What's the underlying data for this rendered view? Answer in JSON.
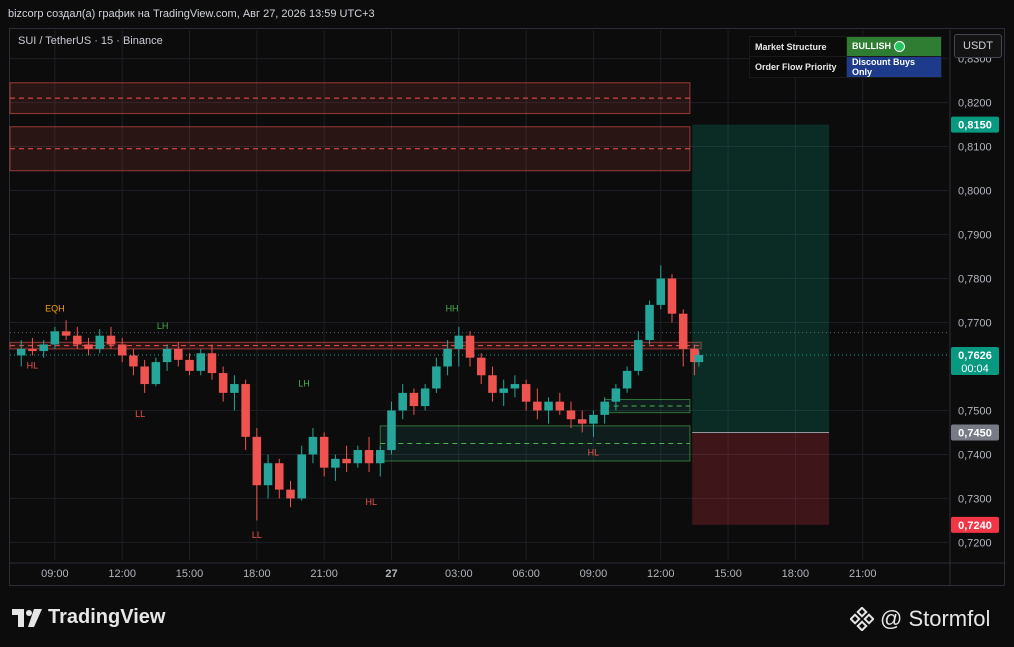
{
  "header": {
    "caption": "bizcorp создал(а) график на TradingView.com, Авг 27, 2026 13:59 UTC+3",
    "symbol": "SUI / TetherUS · 15 · Binance",
    "currency": "USDT"
  },
  "status_table": {
    "row1_label": "Market Structure",
    "row1_value": "BULLISH",
    "row2_label": "Order Flow Priority",
    "row2_value": "Discount Buys Only"
  },
  "footer": {
    "logo": "TradingView",
    "credit": "@ Stormfol"
  },
  "colors": {
    "up": "#26a69a",
    "down": "#ef5350",
    "bg": "#0c0c0c",
    "accent_green": "#22ab94",
    "accent_red": "#f23645"
  },
  "chart_data": {
    "type": "candlestick",
    "ylim": [
      0.716,
      0.8365
    ],
    "y_ticks": [
      "0,8300",
      "0,8200",
      "0,8100",
      "0,8000",
      "0,7900",
      "0,7800",
      "0,7700",
      "0,7500",
      "0,7400",
      "0,7300",
      "0,7200"
    ],
    "y_tick_values": [
      0.83,
      0.82,
      0.81,
      0.8,
      0.79,
      0.78,
      0.77,
      0.75,
      0.74,
      0.73,
      0.72
    ],
    "x_ticks": [
      "09:00",
      "12:00",
      "15:00",
      "18:00",
      "21:00",
      "27",
      "03:00",
      "06:00",
      "09:00",
      "12:00",
      "15:00",
      "18:00",
      "21:00"
    ],
    "x_tick_hours": [
      9,
      12,
      15,
      18,
      21,
      24,
      27,
      30,
      33,
      36,
      39,
      42,
      45
    ],
    "x_range_hours": [
      7.0,
      48.8
    ],
    "last_bar_hour": 37.7,
    "price_labels": [
      {
        "text": "0,8150",
        "value": 0.815,
        "color": "#089981"
      },
      {
        "text": "0,7626",
        "sub": "00:04",
        "value": 0.7626,
        "color": "#089981"
      },
      {
        "text": "0,7450",
        "value": 0.745,
        "color": "#787b86"
      },
      {
        "text": "0,7240",
        "value": 0.724,
        "color": "#f23645"
      }
    ],
    "position": {
      "entry": 0.745,
      "target": 0.815,
      "stop": 0.724,
      "start_hour": 37.4,
      "end_hour": 43.5
    },
    "structure_labels": [
      {
        "text": "EQH",
        "hour": 9.0,
        "value": 0.7725,
        "color": "#f59e0b"
      },
      {
        "text": "HL",
        "hour": 8.0,
        "value": 0.7595,
        "color": "#ef5350"
      },
      {
        "text": "LH",
        "hour": 13.8,
        "value": 0.7685,
        "color": "#4caf50"
      },
      {
        "text": "LL",
        "hour": 12.8,
        "value": 0.7485,
        "color": "#ef5350"
      },
      {
        "text": "LH",
        "hour": 20.1,
        "value": 0.7555,
        "color": "#4caf50"
      },
      {
        "text": "LL",
        "hour": 18.0,
        "value": 0.721,
        "color": "#ef5350"
      },
      {
        "text": "HL",
        "hour": 23.1,
        "value": 0.7285,
        "color": "#ef5350"
      },
      {
        "text": "HH",
        "hour": 26.7,
        "value": 0.7725,
        "color": "#4caf50"
      },
      {
        "text": "HL",
        "hour": 33.0,
        "value": 0.7398,
        "color": "#ef5350"
      }
    ],
    "zones": [
      {
        "y1": 0.8245,
        "y2": 0.8175,
        "h1": 7.0,
        "h2": 37.3,
        "color": "red"
      },
      {
        "y1": 0.8145,
        "y2": 0.8045,
        "h1": 7.0,
        "h2": 37.3,
        "color": "red"
      },
      {
        "y1": 0.7655,
        "y2": 0.764,
        "h1": 7.0,
        "h2": 37.8,
        "color": "red"
      },
      {
        "y1": 0.7465,
        "y2": 0.7385,
        "h1": 23.5,
        "h2": 37.3,
        "color": "green"
      },
      {
        "y1": 0.7525,
        "y2": 0.7495,
        "h1": 33.5,
        "h2": 37.3,
        "color": "green"
      }
    ],
    "candles": [
      [
        7.5,
        0.7625,
        0.766,
        0.76,
        0.764
      ],
      [
        8.0,
        0.764,
        0.7665,
        0.7625,
        0.7635
      ],
      [
        8.5,
        0.7635,
        0.766,
        0.762,
        0.765
      ],
      [
        9.0,
        0.765,
        0.769,
        0.764,
        0.768
      ],
      [
        9.5,
        0.768,
        0.7705,
        0.766,
        0.767
      ],
      [
        10.0,
        0.767,
        0.769,
        0.764,
        0.765
      ],
      [
        10.5,
        0.765,
        0.7665,
        0.7625,
        0.764
      ],
      [
        11.0,
        0.764,
        0.7685,
        0.763,
        0.767
      ],
      [
        11.5,
        0.767,
        0.769,
        0.764,
        0.765
      ],
      [
        12.0,
        0.765,
        0.7665,
        0.761,
        0.7625
      ],
      [
        12.5,
        0.7625,
        0.764,
        0.758,
        0.76
      ],
      [
        13.0,
        0.76,
        0.7615,
        0.754,
        0.756
      ],
      [
        13.5,
        0.756,
        0.762,
        0.7555,
        0.761
      ],
      [
        14.0,
        0.761,
        0.765,
        0.759,
        0.764
      ],
      [
        14.5,
        0.764,
        0.7655,
        0.76,
        0.7615
      ],
      [
        15.0,
        0.7615,
        0.763,
        0.758,
        0.759
      ],
      [
        15.5,
        0.759,
        0.764,
        0.758,
        0.763
      ],
      [
        16.0,
        0.763,
        0.765,
        0.757,
        0.7585
      ],
      [
        16.5,
        0.7585,
        0.76,
        0.752,
        0.754
      ],
      [
        17.0,
        0.754,
        0.758,
        0.75,
        0.756
      ],
      [
        17.5,
        0.756,
        0.757,
        0.741,
        0.744
      ],
      [
        18.0,
        0.744,
        0.746,
        0.725,
        0.733
      ],
      [
        18.5,
        0.733,
        0.74,
        0.73,
        0.738
      ],
      [
        19.0,
        0.738,
        0.739,
        0.73,
        0.732
      ],
      [
        19.5,
        0.732,
        0.734,
        0.728,
        0.73
      ],
      [
        20.0,
        0.73,
        0.742,
        0.7295,
        0.74
      ],
      [
        20.5,
        0.74,
        0.746,
        0.738,
        0.744
      ],
      [
        21.0,
        0.744,
        0.745,
        0.735,
        0.737
      ],
      [
        21.5,
        0.737,
        0.74,
        0.734,
        0.739
      ],
      [
        22.0,
        0.739,
        0.742,
        0.736,
        0.738
      ],
      [
        22.5,
        0.738,
        0.742,
        0.737,
        0.741
      ],
      [
        23.0,
        0.741,
        0.744,
        0.736,
        0.738
      ],
      [
        23.5,
        0.738,
        0.742,
        0.735,
        0.741
      ],
      [
        24.0,
        0.741,
        0.752,
        0.74,
        0.75
      ],
      [
        24.5,
        0.75,
        0.756,
        0.748,
        0.754
      ],
      [
        25.0,
        0.754,
        0.755,
        0.749,
        0.751
      ],
      [
        25.5,
        0.751,
        0.756,
        0.75,
        0.755
      ],
      [
        26.0,
        0.755,
        0.762,
        0.754,
        0.76
      ],
      [
        26.5,
        0.76,
        0.766,
        0.758,
        0.764
      ],
      [
        27.0,
        0.764,
        0.769,
        0.76,
        0.767
      ],
      [
        27.5,
        0.767,
        0.768,
        0.76,
        0.762
      ],
      [
        28.0,
        0.762,
        0.763,
        0.756,
        0.758
      ],
      [
        28.5,
        0.758,
        0.76,
        0.752,
        0.754
      ],
      [
        29.0,
        0.754,
        0.757,
        0.751,
        0.755
      ],
      [
        29.5,
        0.755,
        0.758,
        0.753,
        0.756
      ],
      [
        30.0,
        0.756,
        0.757,
        0.75,
        0.752
      ],
      [
        30.5,
        0.752,
        0.755,
        0.748,
        0.75
      ],
      [
        31.0,
        0.75,
        0.753,
        0.747,
        0.752
      ],
      [
        31.5,
        0.752,
        0.754,
        0.749,
        0.75
      ],
      [
        32.0,
        0.75,
        0.752,
        0.746,
        0.748
      ],
      [
        32.5,
        0.748,
        0.75,
        0.745,
        0.747
      ],
      [
        33.0,
        0.747,
        0.75,
        0.744,
        0.749
      ],
      [
        33.5,
        0.749,
        0.753,
        0.747,
        0.752
      ],
      [
        34.0,
        0.752,
        0.756,
        0.75,
        0.755
      ],
      [
        34.5,
        0.755,
        0.76,
        0.754,
        0.759
      ],
      [
        35.0,
        0.759,
        0.768,
        0.758,
        0.766
      ],
      [
        35.5,
        0.766,
        0.775,
        0.765,
        0.774
      ],
      [
        36.0,
        0.774,
        0.783,
        0.773,
        0.78
      ],
      [
        36.5,
        0.78,
        0.781,
        0.77,
        0.772
      ],
      [
        37.0,
        0.772,
        0.773,
        0.76,
        0.764
      ],
      [
        37.5,
        0.764,
        0.765,
        0.758,
        0.761
      ],
      [
        37.7,
        0.761,
        0.7635,
        0.76,
        0.7626
      ]
    ]
  }
}
